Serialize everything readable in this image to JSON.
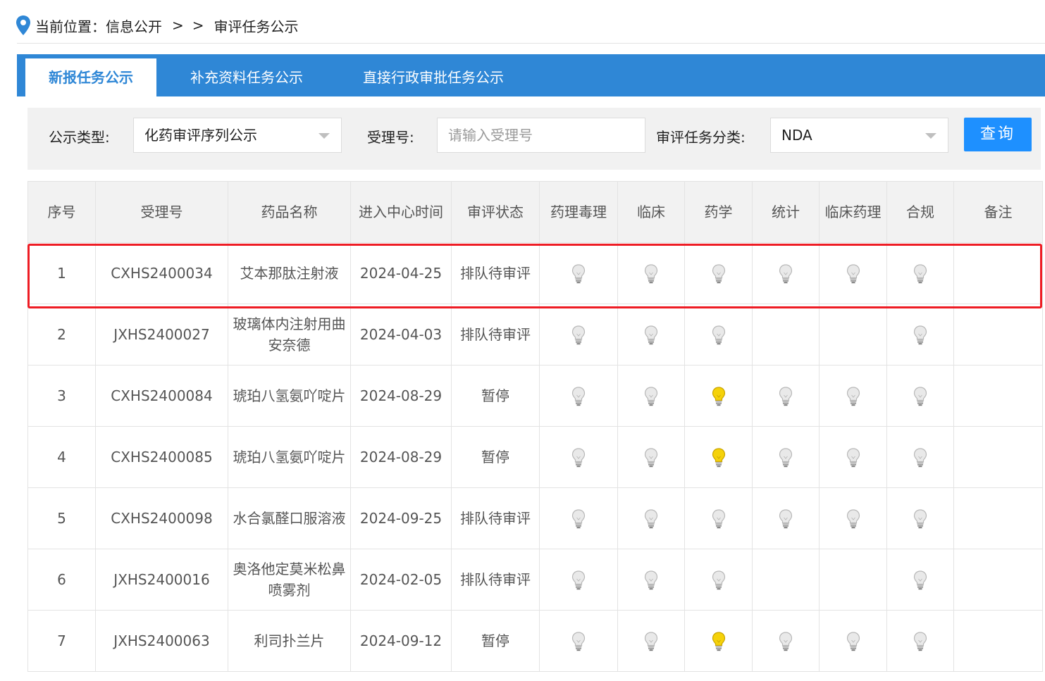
{
  "breadcrumb": {
    "prefix": "当前位置：信息公开",
    "sep1": ">",
    "sep2": ">",
    "current": "审评任务公示"
  },
  "tabs": [
    {
      "label": "新报任务公示",
      "active": true
    },
    {
      "label": "补充资料任务公示",
      "active": false
    },
    {
      "label": "直接行政审批任务公示",
      "active": false
    }
  ],
  "filter": {
    "type_label": "公示类型:",
    "type_value": "化药审评序列公示",
    "accept_label": "受理号:",
    "accept_placeholder": "请输入受理号",
    "category_label": "审评任务分类:",
    "category_value": "NDA",
    "query_label": "查询"
  },
  "table": {
    "headers": [
      "序号",
      "受理号",
      "药品名称",
      "进入中心时间",
      "审评状态",
      "药理毒理",
      "临床",
      "药学",
      "统计",
      "临床药理",
      "合规",
      "备注"
    ],
    "rows": [
      {
        "no": "1",
        "id": "CXHS2400034",
        "name": "艾本那肽注射液",
        "date": "2024-04-25",
        "status": "排队待审评",
        "bulbs": [
          "off",
          "off",
          "off",
          "off",
          "off",
          "off"
        ],
        "note": ""
      },
      {
        "no": "2",
        "id": "JXHS2400027",
        "name": "玻璃体内注射用曲安奈德",
        "date": "2024-04-03",
        "status": "排队待审评",
        "bulbs": [
          "off",
          "off",
          "off",
          "none",
          "none",
          "off"
        ],
        "note": ""
      },
      {
        "no": "3",
        "id": "CXHS2400084",
        "name": "琥珀八氢氨吖啶片",
        "date": "2024-08-29",
        "status": "暂停",
        "bulbs": [
          "off",
          "off",
          "on",
          "off",
          "off",
          "off"
        ],
        "note": ""
      },
      {
        "no": "4",
        "id": "CXHS2400085",
        "name": "琥珀八氢氨吖啶片",
        "date": "2024-08-29",
        "status": "暂停",
        "bulbs": [
          "off",
          "off",
          "on",
          "off",
          "off",
          "off"
        ],
        "note": ""
      },
      {
        "no": "5",
        "id": "CXHS2400098",
        "name": "水合氯醛口服溶液",
        "date": "2024-09-25",
        "status": "排队待审评",
        "bulbs": [
          "off",
          "off",
          "off",
          "off",
          "off",
          "off"
        ],
        "note": ""
      },
      {
        "no": "6",
        "id": "JXHS2400016",
        "name": "奥洛他定莫米松鼻喷雾剂",
        "date": "2024-02-05",
        "status": "排队待审评",
        "bulbs": [
          "off",
          "off",
          "off",
          "none",
          "none",
          "off"
        ],
        "note": ""
      },
      {
        "no": "7",
        "id": "JXHS2400063",
        "name": "利司扑兰片",
        "date": "2024-09-12",
        "status": "暂停",
        "bulbs": [
          "off",
          "off",
          "on",
          "off",
          "off",
          "off"
        ],
        "note": ""
      }
    ]
  },
  "colors": {
    "tab_bar": "#2f87d6",
    "query_button": "#1e90ff",
    "highlight_border": "#ee1c24",
    "bulb_on": "#f5d20a",
    "bulb_off": "#e9e9e9"
  },
  "icons": {
    "location": "location-pin-icon",
    "bulb": "lightbulb-icon",
    "dropdown": "chevron-down-icon"
  }
}
